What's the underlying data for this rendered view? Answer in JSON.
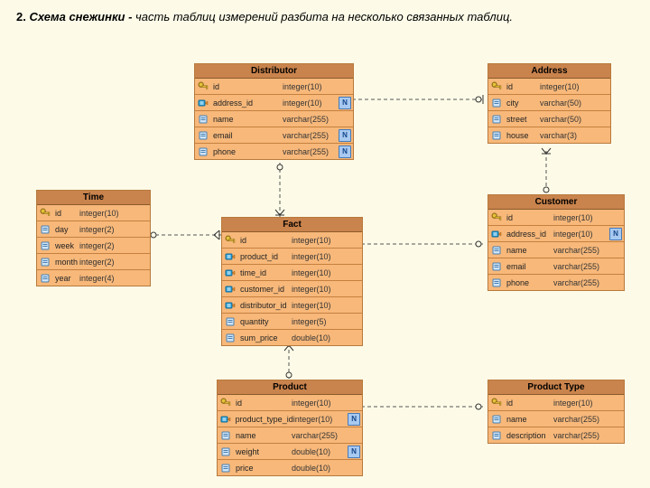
{
  "heading": {
    "num": "2. ",
    "title": "Схема снежинки - ",
    "desc": "часть таблиц измерений разбита на несколько связанных таблиц."
  },
  "iconKinds": {
    "pk": "key-icon",
    "fk": "fk-icon",
    "col": "column-icon"
  },
  "tables": {
    "distributor": {
      "title": "Distributor",
      "rows": [
        {
          "icon": "pk",
          "name": "id",
          "type": "integer(10)",
          "nn": false
        },
        {
          "icon": "fk",
          "name": "address_id",
          "type": "integer(10)",
          "nn": true
        },
        {
          "icon": "col",
          "name": "name",
          "type": "varchar(255)",
          "nn": false
        },
        {
          "icon": "col",
          "name": "email",
          "type": "varchar(255)",
          "nn": true
        },
        {
          "icon": "col",
          "name": "phone",
          "type": "varchar(255)",
          "nn": true
        }
      ]
    },
    "address": {
      "title": "Address",
      "rows": [
        {
          "icon": "pk",
          "name": "id",
          "type": "integer(10)",
          "nn": false
        },
        {
          "icon": "col",
          "name": "city",
          "type": "varchar(50)",
          "nn": false
        },
        {
          "icon": "col",
          "name": "street",
          "type": "varchar(50)",
          "nn": false
        },
        {
          "icon": "col",
          "name": "house",
          "type": "varchar(3)",
          "nn": false
        }
      ]
    },
    "time": {
      "title": "Time",
      "rows": [
        {
          "icon": "pk",
          "name": "id",
          "type": "integer(10)",
          "nn": false
        },
        {
          "icon": "col",
          "name": "day",
          "type": "integer(2)",
          "nn": false
        },
        {
          "icon": "col",
          "name": "week",
          "type": "integer(2)",
          "nn": false
        },
        {
          "icon": "col",
          "name": "month",
          "type": "integer(2)",
          "nn": false
        },
        {
          "icon": "col",
          "name": "year",
          "type": "integer(4)",
          "nn": false
        }
      ]
    },
    "customer": {
      "title": "Customer",
      "rows": [
        {
          "icon": "pk",
          "name": "id",
          "type": "integer(10)",
          "nn": false
        },
        {
          "icon": "fk",
          "name": "address_id",
          "type": "integer(10)",
          "nn": true
        },
        {
          "icon": "col",
          "name": "name",
          "type": "varchar(255)",
          "nn": false
        },
        {
          "icon": "col",
          "name": "email",
          "type": "varchar(255)",
          "nn": false
        },
        {
          "icon": "col",
          "name": "phone",
          "type": "varchar(255)",
          "nn": false
        }
      ]
    },
    "fact": {
      "title": "Fact",
      "rows": [
        {
          "icon": "pk",
          "name": "id",
          "type": "integer(10)",
          "nn": false
        },
        {
          "icon": "fk",
          "name": "product_id",
          "type": "integer(10)",
          "nn": false
        },
        {
          "icon": "fk",
          "name": "time_id",
          "type": "integer(10)",
          "nn": false
        },
        {
          "icon": "fk",
          "name": "customer_id",
          "type": "integer(10)",
          "nn": false
        },
        {
          "icon": "fk",
          "name": "distributor_id",
          "type": "integer(10)",
          "nn": false
        },
        {
          "icon": "col",
          "name": "quantity",
          "type": "integer(5)",
          "nn": false
        },
        {
          "icon": "col",
          "name": "sum_price",
          "type": "double(10)",
          "nn": false
        }
      ]
    },
    "product": {
      "title": "Product",
      "rows": [
        {
          "icon": "pk",
          "name": "id",
          "type": "integer(10)",
          "nn": false
        },
        {
          "icon": "fk",
          "name": "product_type_id",
          "type": "integer(10)",
          "nn": true
        },
        {
          "icon": "col",
          "name": "name",
          "type": "varchar(255)",
          "nn": false
        },
        {
          "icon": "col",
          "name": "weight",
          "type": "double(10)",
          "nn": true
        },
        {
          "icon": "col",
          "name": "price",
          "type": "double(10)",
          "nn": false
        }
      ]
    },
    "ptype": {
      "title": "Product Type",
      "rows": [
        {
          "icon": "pk",
          "name": "id",
          "type": "integer(10)",
          "nn": false
        },
        {
          "icon": "col",
          "name": "name",
          "type": "varchar(255)",
          "nn": false
        },
        {
          "icon": "col",
          "name": "description",
          "type": "varchar(255)",
          "nn": false
        }
      ]
    }
  }
}
